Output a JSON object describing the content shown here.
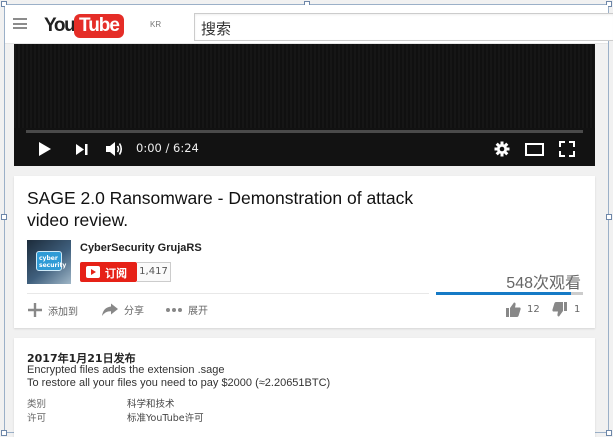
{
  "header": {
    "logo_you": "You",
    "logo_tube": "Tube",
    "region": "KR",
    "search_placeholder": "搜索"
  },
  "player": {
    "time": "0:00 / 6:24",
    "progress": 0
  },
  "video": {
    "title": "SAGE 2.0 Ransomware - Demonstration of attack video review.",
    "channel_name": "CyberSecurity GrujaRS",
    "subscribe_label": "订阅",
    "subscriber_count": "1,417",
    "view_count": "548次观看",
    "like_ratio": 0.92,
    "actions": {
      "add_to": "添加到",
      "share": "分享",
      "more": "展开"
    },
    "likes": "12",
    "dislikes": "1"
  },
  "description": {
    "published": "2017年1月21日发布",
    "lines": [
      "Encrypted files adds the extension .sage",
      "To restore all your files you need to pay $2000 (≈2.20651BTC)"
    ],
    "meta": [
      {
        "key": "类别",
        "value": "科学和技术"
      },
      {
        "key": "许可",
        "value": "标准YouTube许可"
      }
    ]
  },
  "colors": {
    "brand_red": "#e52d27",
    "subscribe_red": "#e62117",
    "like_blue": "#167ac6"
  }
}
